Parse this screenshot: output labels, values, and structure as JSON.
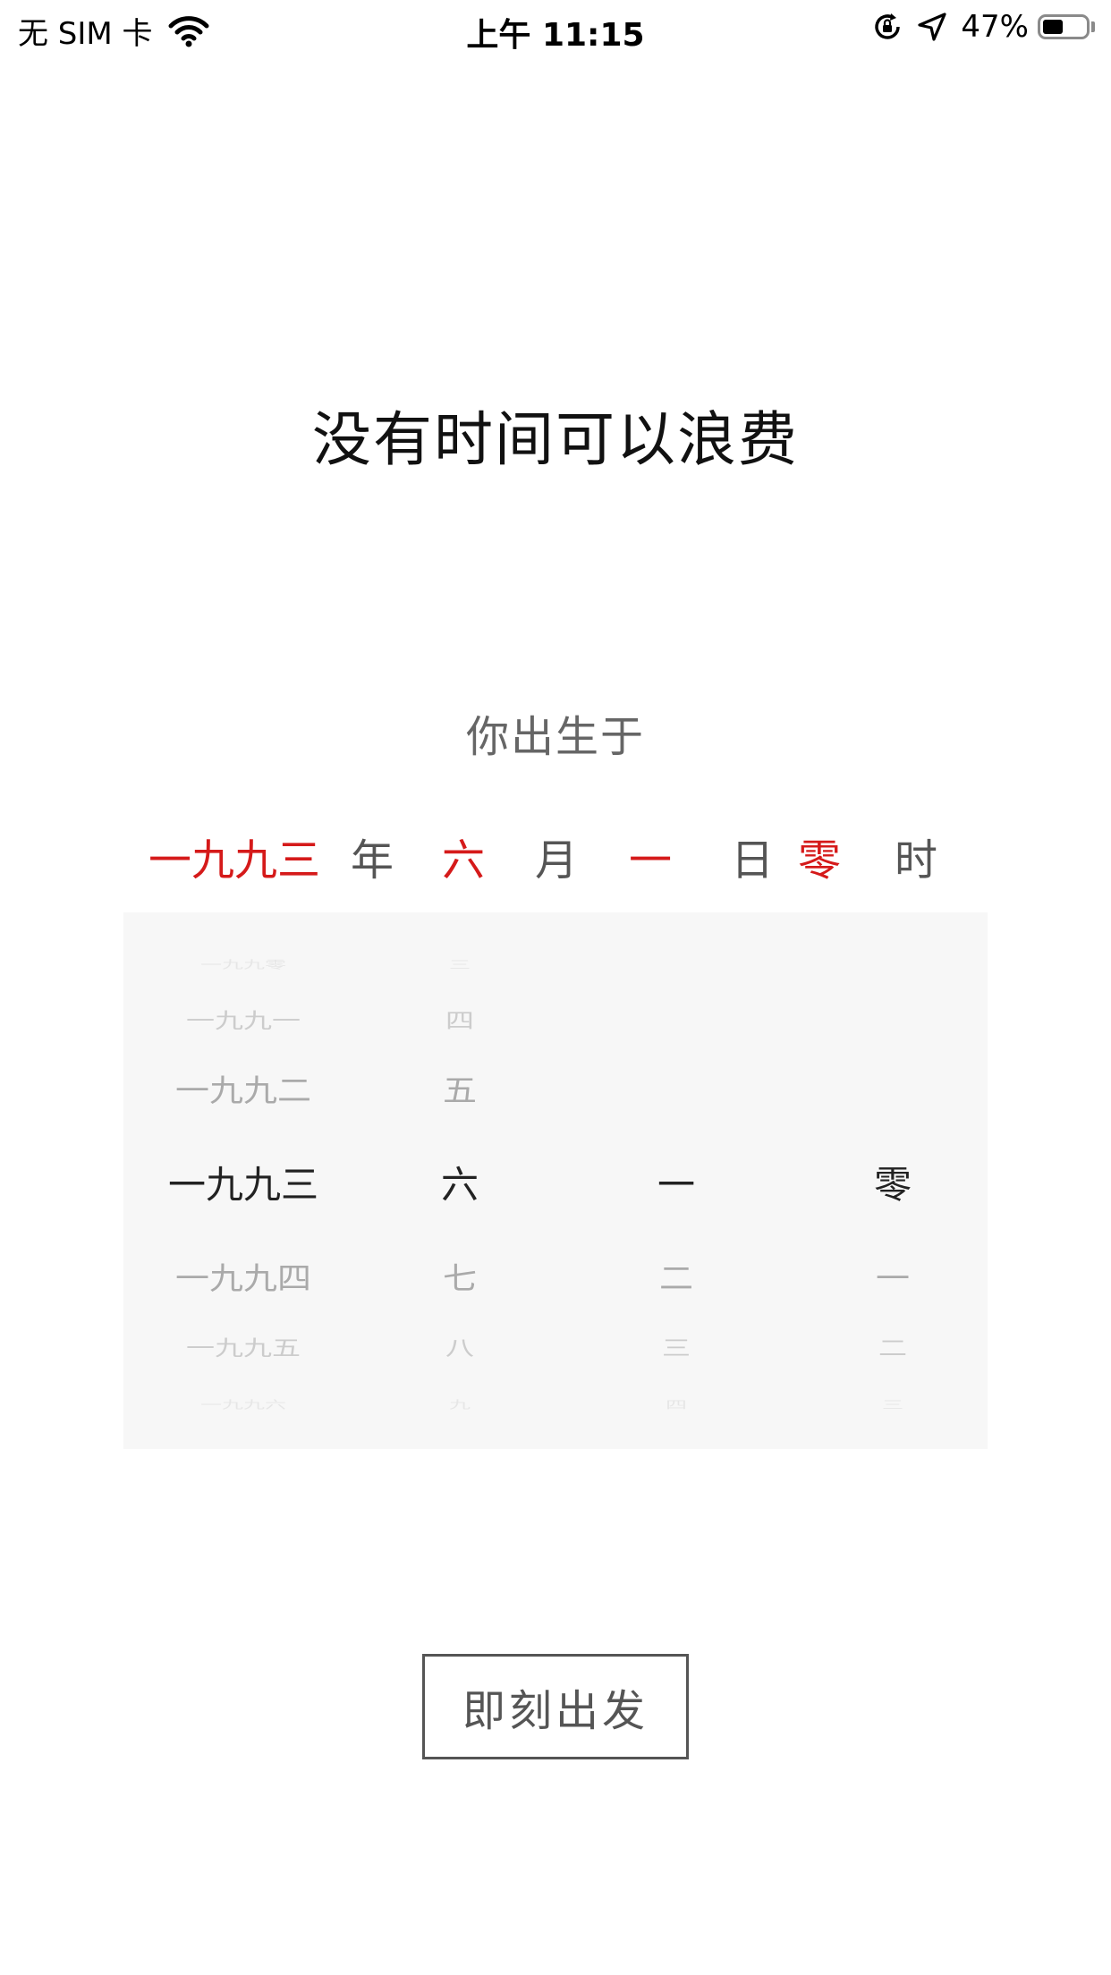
{
  "status_bar": {
    "carrier": "无 SIM 卡",
    "time": "上午 11:15",
    "battery": "47%",
    "battery_level": 0.47,
    "icons": [
      "wifi-icon",
      "orientation-lock-icon",
      "location-arrow-icon",
      "battery-icon"
    ]
  },
  "title": "没有时间可以浪费",
  "subtitle": "你出生于",
  "selection": {
    "year": "一九九三",
    "year_unit": "年",
    "month": "六",
    "month_unit": "月",
    "day": "一",
    "day_unit": "日",
    "hour": "零",
    "hour_unit": "时",
    "accent_color": "#d51a1a"
  },
  "picker": {
    "year": [
      "一九九零",
      "一九九一",
      "一九九二",
      "一九九三",
      "一九九四",
      "一九九五",
      "一九九六"
    ],
    "month": [
      "三",
      "四",
      "五",
      "六",
      "七",
      "八",
      "九"
    ],
    "day": [
      "一",
      "二",
      "三",
      "四"
    ],
    "hour": [
      "零",
      "一",
      "二",
      "三"
    ]
  },
  "start_button": "即刻出发"
}
